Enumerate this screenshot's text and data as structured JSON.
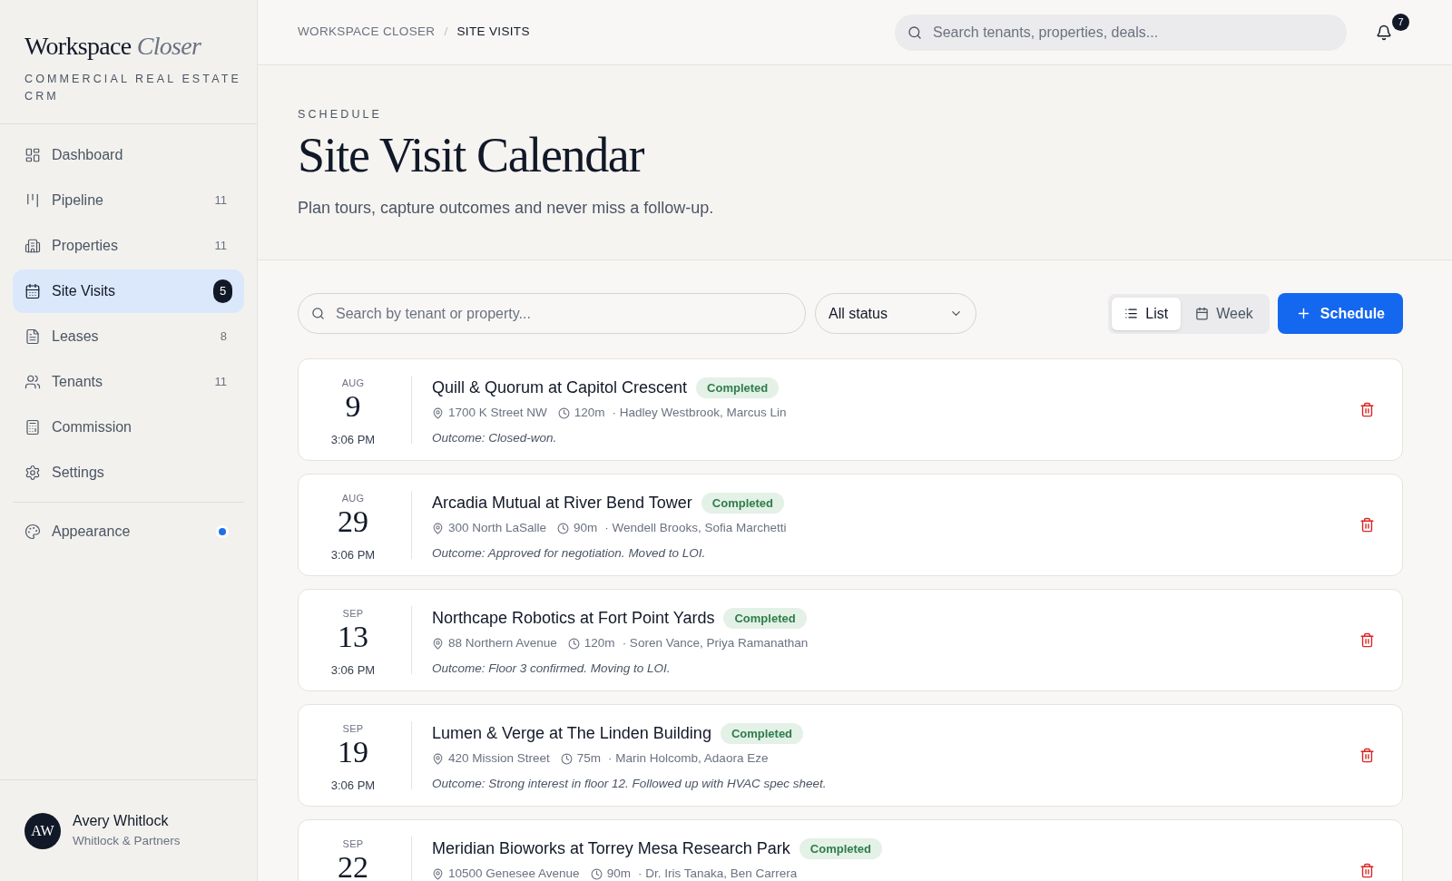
{
  "brand": {
    "name": "Workspace",
    "name_accent": "Closer",
    "tagline": "COMMERCIAL REAL ESTATE CRM"
  },
  "sidebar": {
    "items": [
      {
        "label": "Dashboard",
        "selected": false
      },
      {
        "label": "Pipeline",
        "count": "11",
        "selected": false
      },
      {
        "label": "Properties",
        "count": "11",
        "selected": false
      },
      {
        "label": "Site Visits",
        "count": "5",
        "selected": true
      },
      {
        "label": "Leases",
        "count": "8",
        "selected": false
      },
      {
        "label": "Tenants",
        "count": "11",
        "selected": false
      },
      {
        "label": "Commission",
        "selected": false
      },
      {
        "label": "Settings",
        "selected": false
      }
    ],
    "appearance": {
      "label": "Appearance",
      "dot": true
    }
  },
  "user": {
    "initials": "AW",
    "name": "Avery Whitlock",
    "company": "Whitlock & Partners"
  },
  "breadcrumb": {
    "separator": "/",
    "items": [
      "WORKSPACE CLOSER",
      "SITE VISITS"
    ]
  },
  "global_search": {
    "placeholder": "Search tenants, properties, deals..."
  },
  "notifications": {
    "count": "7"
  },
  "hero": {
    "eyebrow": "SCHEDULE",
    "title": "Site Visit Calendar",
    "subtitle": "Plan tours, capture outcomes and never miss a follow-up."
  },
  "toolbar": {
    "search": {
      "placeholder": "Search by tenant or property..."
    },
    "status_filter": "All status",
    "views": [
      {
        "label": "List",
        "selected": true
      },
      {
        "label": "Week",
        "selected": false
      }
    ],
    "schedule_button": "Schedule"
  },
  "visits": [
    {
      "month": "AUG",
      "day": "9",
      "time": "3:06 PM",
      "title": "Quill & Quorum at Capitol Crescent",
      "status": "Completed",
      "address": "1700 K Street NW",
      "duration": "120m",
      "attendees": "· Hadley Westbrook, Marcus Lin",
      "outcome": "Outcome: Closed-won."
    },
    {
      "month": "AUG",
      "day": "29",
      "time": "3:06 PM",
      "title": "Arcadia Mutual at River Bend Tower",
      "status": "Completed",
      "address": "300 North LaSalle",
      "duration": "90m",
      "attendees": "· Wendell Brooks, Sofia Marchetti",
      "outcome": "Outcome: Approved for negotiation. Moved to LOI."
    },
    {
      "month": "SEP",
      "day": "13",
      "time": "3:06 PM",
      "title": "Northcape Robotics at Fort Point Yards",
      "status": "Completed",
      "address": "88 Northern Avenue",
      "duration": "120m",
      "attendees": "· Soren Vance, Priya Ramanathan",
      "outcome": "Outcome: Floor 3 confirmed. Moving to LOI."
    },
    {
      "month": "SEP",
      "day": "19",
      "time": "3:06 PM",
      "title": "Lumen & Verge at The Linden Building",
      "status": "Completed",
      "address": "420 Mission Street",
      "duration": "75m",
      "attendees": "· Marin Holcomb, Adaora Eze",
      "outcome": "Outcome: Strong interest in floor 12. Followed up with HVAC spec sheet."
    },
    {
      "month": "SEP",
      "day": "22",
      "title": "Meridian Bioworks at Torrey Mesa Research Park",
      "status": "Completed",
      "address": "10500 Genesee Avenue",
      "duration": "90m",
      "attendees": "· Dr. Iris Tanaka, Ben Carrera"
    }
  ]
}
